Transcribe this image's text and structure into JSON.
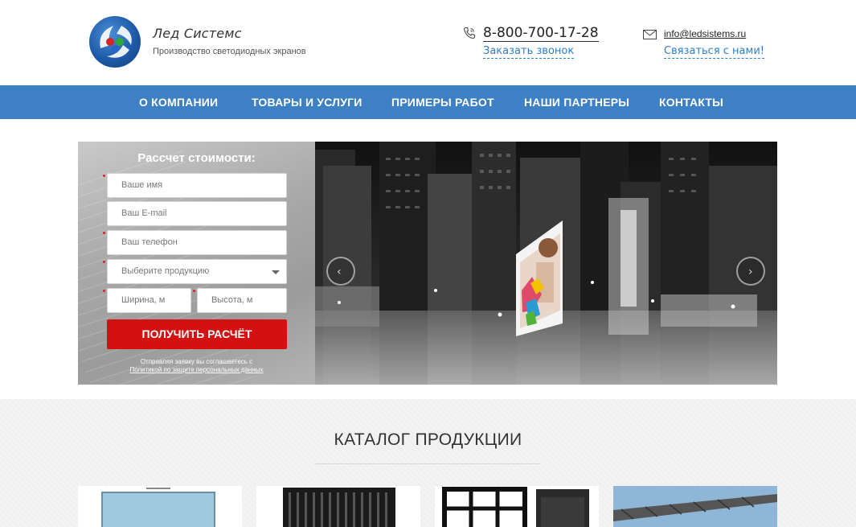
{
  "header": {
    "brand_name": "Лед Системс",
    "tagline": "Производство светодиодных экранов",
    "phone": "8-800-700-17-28",
    "callback_label": "Заказать звонок",
    "email": "info@ledsistems.ru",
    "contact_label": "Связаться с нами!"
  },
  "nav": {
    "items": [
      {
        "label": "О КОМПАНИИ"
      },
      {
        "label": "ТОВАРЫ И УСЛУГИ"
      },
      {
        "label": "ПРИМЕРЫ РАБОТ"
      },
      {
        "label": "НАШИ ПАРТНЕРЫ"
      },
      {
        "label": "КОНТАКТЫ"
      }
    ]
  },
  "form": {
    "title": "Рассчет стоимости:",
    "name_placeholder": "Ваше имя",
    "email_placeholder": "Ваш E-mail",
    "phone_placeholder": "Ваш телефон",
    "product_placeholder": "Выберите продукцию",
    "width_placeholder": "Ширина, м",
    "height_placeholder": "Высота, м",
    "submit_label": "ПОЛУЧИТЬ РАСЧЁТ",
    "consent_text": "Отправляя заявку вы соглашаетесь с",
    "policy_link": "Политикой по защите персональных данных"
  },
  "slider": {
    "prev_icon": "chevron-left-icon",
    "next_icon": "chevron-right-icon"
  },
  "catalog": {
    "title": "КАТАЛОГ ПРОДУКЦИИ"
  },
  "colors": {
    "nav_blue": "#3d80c4",
    "link_blue": "#2e7dc7",
    "submit_red": "#d41111"
  }
}
